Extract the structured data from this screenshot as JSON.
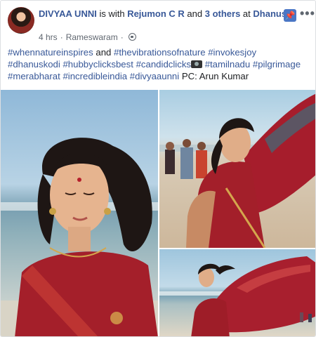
{
  "post": {
    "author": "DIVYAA UNNI",
    "with_text": " is with ",
    "tagged_person": "Rejumon C R",
    "and_text": " and ",
    "others_text": "3 others",
    "at_text": " at ",
    "location": "Dhanushkodi Beach, Srilanka Border.",
    "time": "4 hrs",
    "place": "Rameswaram",
    "icons": {
      "privacy": "globe-icon",
      "pin": "pin-icon",
      "more": "more-options-icon",
      "camera": "camera-emoji-icon"
    },
    "colors": {
      "link": "#385898",
      "text": "#1c1e21",
      "muted": "#606770"
    }
  },
  "caption": {
    "t1": "#whennatureinspires",
    "and": " and ",
    "t2": "#thevibrationsofnature",
    "t3": "#invokesjoy",
    "t4": "#dhanuskodi",
    "t5": "#hubbyclicksbest",
    "t6": "#candidclicks",
    "t7": "#tamilnadu",
    "t8": "#pilgrimage",
    "t9": "#merabharat",
    "t10": "#incredibleindia",
    "t11": "#divyaaunni",
    "credit": " PC: Arun Kumar"
  }
}
